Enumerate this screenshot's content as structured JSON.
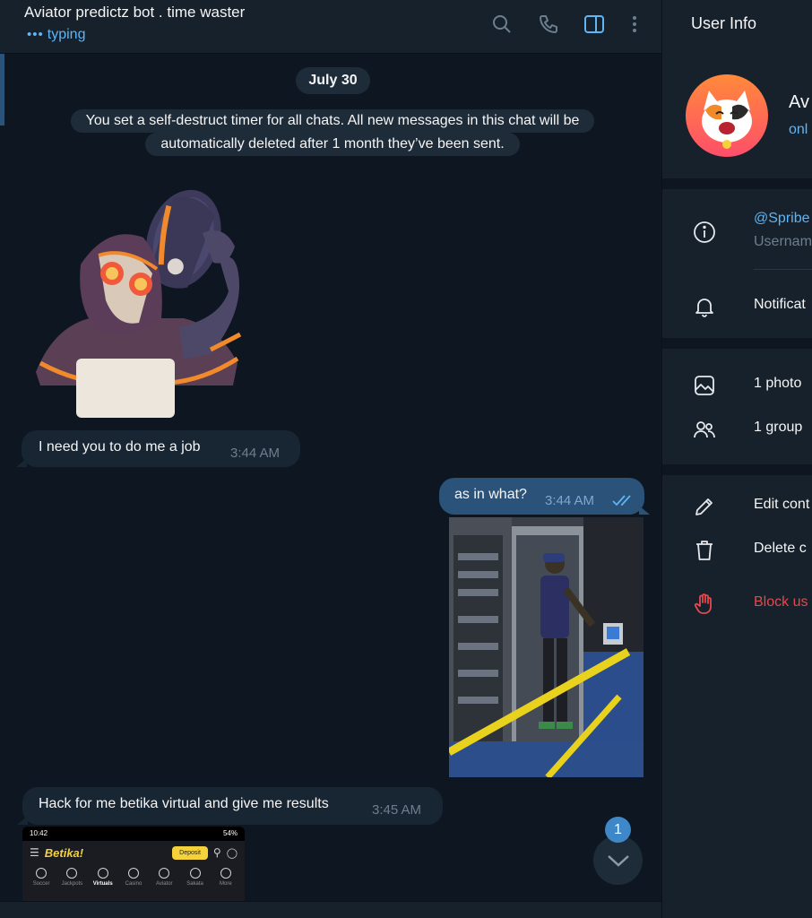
{
  "chat": {
    "title": "Aviator predictz bot . time waster",
    "status": "typing",
    "status_dots": "•••",
    "header_icons": [
      "search-icon",
      "phone-icon",
      "sidebar-toggle-icon",
      "more-vert-icon"
    ],
    "date_separator": "July 30",
    "service_message_line1": "You set a self-destruct timer for all chats. All new messages in this chat will be",
    "service_message_line2": "automatically deleted after 1 month they’ve been sent.",
    "messages": [
      {
        "direction": "in",
        "text": "I need you to do me a job",
        "time": "3:44 AM"
      },
      {
        "direction": "out",
        "text": "as in what?",
        "time": "3:44 AM",
        "read": true
      },
      {
        "direction": "in",
        "text": "Hack for me betika virtual and give me results",
        "time": "3:45 AM"
      }
    ],
    "screenshot_thumb": {
      "status_time": "10:42",
      "battery": "54%",
      "logo": "Betika!",
      "deposit_label": "Deposit",
      "tabs": [
        "Soccer",
        "Jackpots",
        "Virtuals",
        "Casino",
        "Aviator",
        "Sakata",
        "More"
      ],
      "active_tab": "Virtuals"
    },
    "unread_count": "1"
  },
  "panel": {
    "title": "User Info",
    "name": "Av",
    "online": "onl",
    "username": "@Spribe",
    "username_caption": "Usernam",
    "notifications": "Notificat",
    "photos": "1 photo",
    "groups": "1 group",
    "edit": "Edit cont",
    "delete": "Delete c",
    "block": "Block us"
  },
  "colors": {
    "background": "#0e1621",
    "header": "#17212b",
    "bubble_in": "#182533",
    "bubble_out": "#2b5278",
    "accent": "#5eb5f7",
    "danger": "#e5484d",
    "badge": "#3e88c9"
  }
}
